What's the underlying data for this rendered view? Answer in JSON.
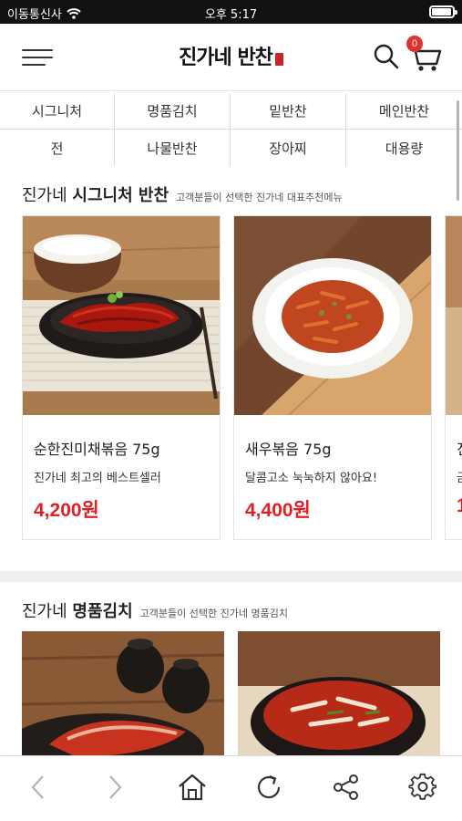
{
  "status_bar": {
    "carrier": "이동통신사",
    "time": "오후 5:17",
    "battery_level": 0.95
  },
  "header": {
    "logo_text": "진가네 반찬",
    "menu_icon": "hamburger-menu-icon",
    "search_icon": "search-icon",
    "cart_icon": "cart-icon",
    "cart_count": "0"
  },
  "categories": [
    "시그니처",
    "명품김치",
    "밑반찬",
    "메인반찬",
    "전",
    "나물반찬",
    "장아찌",
    "대용량"
  ],
  "signature_section": {
    "title_prefix": "진가네",
    "title_bold": "시그니처 반찬",
    "subtitle": "고객분들이 선택한 진가네 대표추천메뉴",
    "products": [
      {
        "name": "순한진미채볶음 75g",
        "desc": "진가네 최고의 베스트셀러",
        "price": "4,200원"
      },
      {
        "name": "새우볶음 75g",
        "desc": "달콤고소 눅눅하지 않아요!",
        "price": "4,400원"
      },
      {
        "name": "진",
        "desc": "금",
        "price": "1"
      }
    ]
  },
  "kimchi_section": {
    "title_prefix": "진가네",
    "title_bold": "명품김치",
    "subtitle": "고객분들이 선택한 진가네 명품김치"
  },
  "toolbar": {
    "back_icon": "back-arrow-icon",
    "forward_icon": "forward-arrow-icon",
    "home_icon": "home-icon",
    "refresh_icon": "refresh-icon",
    "share_icon": "share-icon",
    "settings_icon": "settings-gear-icon"
  },
  "colors": {
    "price_red": "#e41e25",
    "badge_red": "#e03030",
    "status_bar": "#111111"
  }
}
